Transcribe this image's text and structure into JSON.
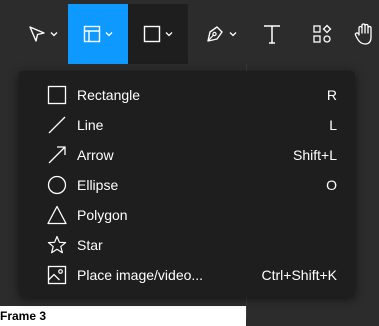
{
  "toolbar": {
    "tools": [
      {
        "name": "move",
        "icon": "pointer-icon",
        "has_chevron": true
      },
      {
        "name": "frame",
        "icon": "frame-icon",
        "has_chevron": true,
        "active": true
      },
      {
        "name": "shape",
        "icon": "rectangle-icon",
        "has_chevron": true,
        "open": true
      },
      {
        "name": "pen",
        "icon": "pen-icon",
        "has_chevron": true
      },
      {
        "name": "text",
        "icon": "text-icon",
        "has_chevron": false
      },
      {
        "name": "resources",
        "icon": "resources-icon",
        "has_chevron": false
      },
      {
        "name": "hand",
        "icon": "hand-icon",
        "has_chevron": false
      }
    ],
    "active_color": "#0d99ff"
  },
  "shape_menu": {
    "items": [
      {
        "label": "Rectangle",
        "shortcut": "R",
        "icon": "rectangle-icon"
      },
      {
        "label": "Line",
        "shortcut": "L",
        "icon": "line-icon"
      },
      {
        "label": "Arrow",
        "shortcut": "Shift+L",
        "icon": "arrow-icon"
      },
      {
        "label": "Ellipse",
        "shortcut": "O",
        "icon": "ellipse-icon"
      },
      {
        "label": "Polygon",
        "shortcut": "",
        "icon": "polygon-icon"
      },
      {
        "label": "Star",
        "shortcut": "",
        "icon": "star-icon"
      },
      {
        "label": "Place image/video...",
        "shortcut": "Ctrl+Shift+K",
        "icon": "image-icon"
      }
    ]
  },
  "layers": {
    "partial_label": "Frame 3"
  }
}
